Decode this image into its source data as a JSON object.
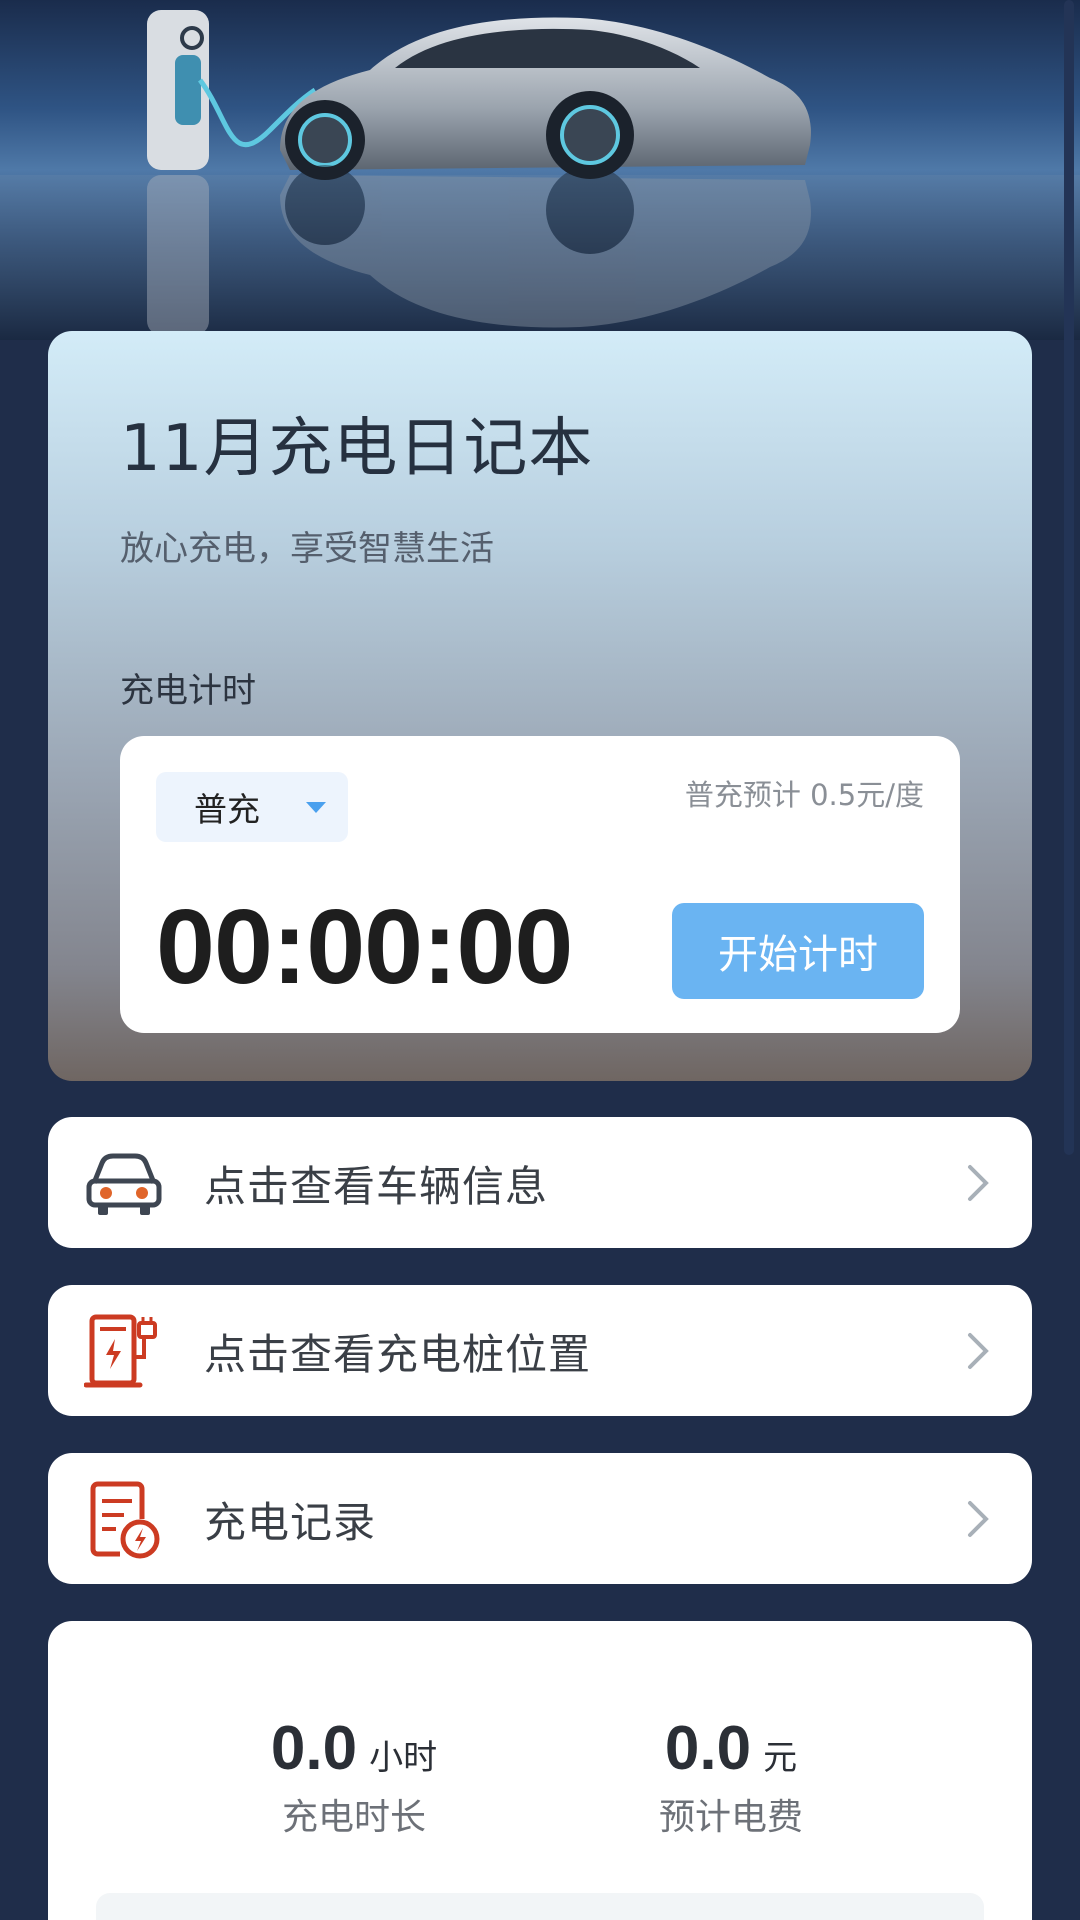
{
  "card": {
    "title": "11月充电日记本",
    "subtitle": "放心充电，享受智慧生活",
    "section_label": "充电计时"
  },
  "timer": {
    "mode": "普充",
    "rate_note": "普充预计 0.5元/度",
    "display": "00:00:00",
    "start_label": "开始计时"
  },
  "menu": [
    {
      "label": "点击查看车辆信息",
      "icon": "car-icon"
    },
    {
      "label": "点击查看充电桩位置",
      "icon": "charging-station-icon"
    },
    {
      "label": "充电记录",
      "icon": "charge-record-icon"
    }
  ],
  "stats": {
    "duration": {
      "value": "0.0",
      "unit": "小时",
      "caption": "充电时长"
    },
    "cost": {
      "value": "0.0",
      "unit": "元",
      "caption": "预计电费"
    }
  },
  "colors": {
    "accent": "#6ab4f2",
    "background": "#1f2d4a",
    "icon_orange": "#e0652a",
    "icon_red": "#cc3b22"
  }
}
